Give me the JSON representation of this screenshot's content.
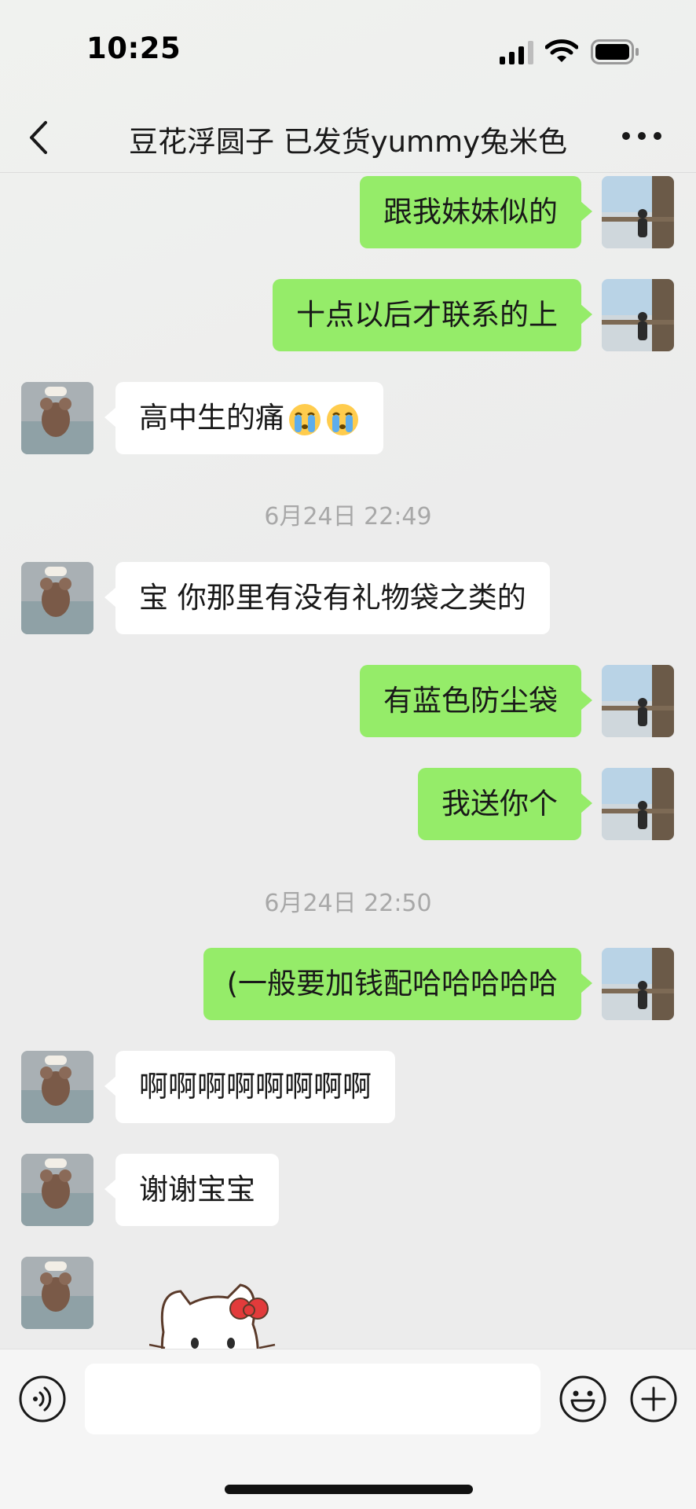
{
  "status_bar": {
    "time": "10:25",
    "icons": [
      "cellular-signal-icon",
      "wifi-icon",
      "battery-icon"
    ]
  },
  "nav": {
    "title": "豆花浮圆子 已发货yummy兔米色",
    "back_icon": "chevron-left-icon",
    "more_icon": "more-dots-icon"
  },
  "messages": [
    {
      "from": "me",
      "text": "跟我妹妹似的"
    },
    {
      "from": "me",
      "text": "十点以后才联系的上"
    },
    {
      "from": "other",
      "text": "高中生的痛",
      "emojis": [
        "crying-face-icon",
        "crying-face-icon"
      ]
    },
    {
      "type": "timestamp",
      "text": "6月24日 22:49"
    },
    {
      "from": "other",
      "text": "宝 你那里有没有礼物袋之类的"
    },
    {
      "from": "me",
      "text": "有蓝色防尘袋"
    },
    {
      "from": "me",
      "text": "我送你个"
    },
    {
      "type": "timestamp",
      "text": "6月24日 22:50"
    },
    {
      "from": "me",
      "text": "(一般要加钱配哈哈哈哈哈"
    },
    {
      "from": "other",
      "text": "啊啊啊啊啊啊啊啊"
    },
    {
      "from": "other",
      "text": "谢谢宝宝"
    },
    {
      "from": "other",
      "type": "sticker",
      "sticker": "hello-kitty-sticker"
    }
  ],
  "input_bar": {
    "placeholder": "",
    "icons": [
      "voice-icon",
      "emoji-face-icon",
      "plus-icon"
    ]
  },
  "colors": {
    "my_bubble": "#95ec69",
    "their_bubble": "#ffffff",
    "background": "#ededed",
    "timestamp_text": "#a8a8a8"
  }
}
